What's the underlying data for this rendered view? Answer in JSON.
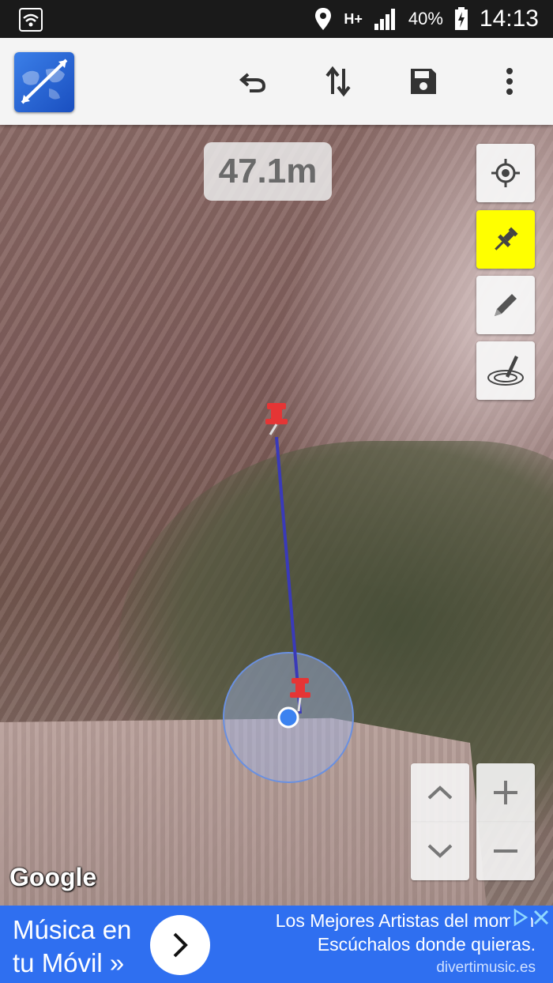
{
  "status_bar": {
    "network_type": "H+",
    "battery_percent": "40%",
    "time": "14:13",
    "icons": [
      "wifi-icon",
      "location-icon",
      "signal-icon",
      "battery-charging-icon"
    ]
  },
  "toolbar": {
    "app_logo": "app-logo-icon",
    "actions": [
      "undo-icon",
      "swap-vertical-icon",
      "save-icon",
      "more-vert-icon"
    ]
  },
  "map": {
    "distance": "47.1m",
    "provider_label": "Google",
    "tools": [
      "my-location-icon",
      "pushpin-icon",
      "pencil-icon",
      "freehand-area-icon"
    ],
    "active_tool": "pushpin-icon",
    "active_color": "#ffff00",
    "line_color": "#3a3ab8",
    "pin_color": "#e53535",
    "location_color": "#3b82f0"
  },
  "zoom_controls": {
    "icons": [
      "chevron-up-icon",
      "chevron-down-icon",
      "zoom-in-icon",
      "zoom-out-icon"
    ]
  },
  "ad": {
    "left_text": "Música en tu Móvil »",
    "headline": "Los Mejores Artistas del momen",
    "subline": "Escúchalos donde quieras.",
    "domain": "divertimusic.es",
    "background": "#2f6ff0"
  }
}
